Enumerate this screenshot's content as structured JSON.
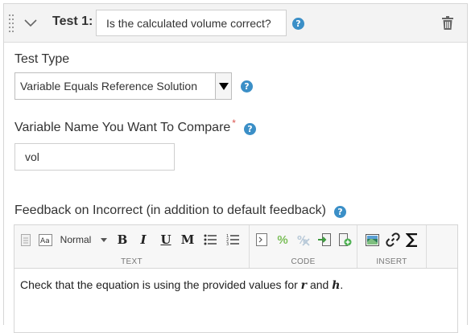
{
  "test": {
    "label": "Test 1:",
    "title_value": "Is the calculated volume correct?"
  },
  "test_type": {
    "label": "Test Type",
    "selected": "Variable Equals Reference Solution"
  },
  "variable_name": {
    "label": "Variable Name You Want To Compare",
    "required_mark": "*",
    "value": "vol"
  },
  "feedback": {
    "label": "Feedback on Incorrect (in addition to default feedback)",
    "toolbar": {
      "style_label": "Normal",
      "bold": "B",
      "italic": "I",
      "underline": "U",
      "mono": "M",
      "groups": {
        "text": "TEXT",
        "code": "CODE",
        "insert": "INSERT"
      }
    },
    "content": {
      "before": "Check that the equation is using the provided values for ",
      "var1": "r",
      "middle": " and ",
      "var2": "h",
      "after": "."
    }
  },
  "icons": {
    "help": "help-circle-icon",
    "trash": "trash-icon",
    "chevron": "chevron-down-icon",
    "drag": "drag-handle-icon"
  },
  "colors": {
    "help_blue": "#3b8fc7",
    "required_red": "#d9534f",
    "header_bg": "#f3f3f3"
  }
}
